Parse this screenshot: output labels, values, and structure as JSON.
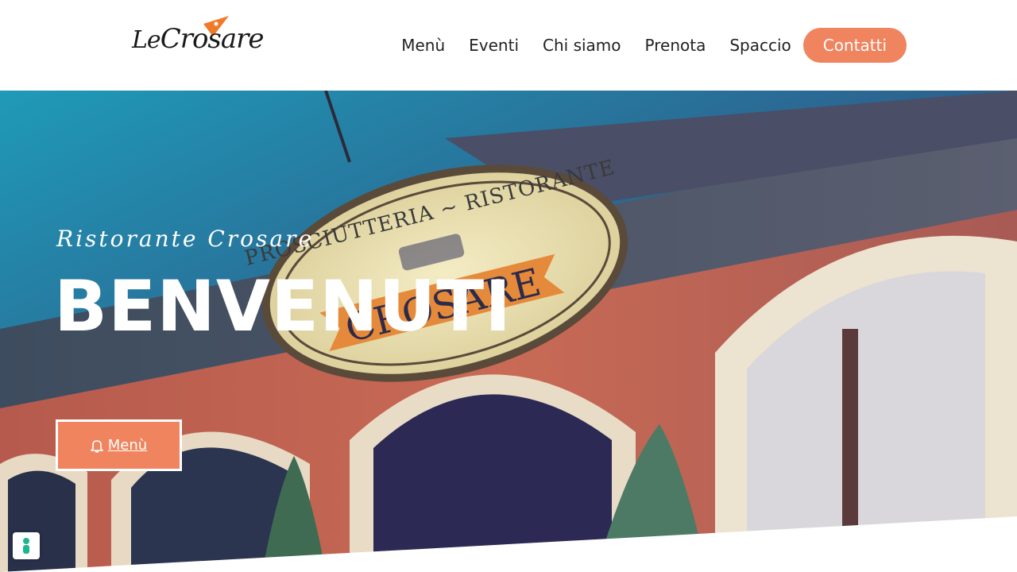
{
  "brand": {
    "logo_text_small": "Le",
    "logo_text_big": "Crosare",
    "accent_color": "#f0845f"
  },
  "nav": {
    "items": [
      {
        "label": "Menù"
      },
      {
        "label": "Eventi"
      },
      {
        "label": "Chi siamo"
      },
      {
        "label": "Prenota"
      },
      {
        "label": "Spaccio"
      }
    ],
    "cta_label": "Contatti"
  },
  "hero": {
    "subtitle": "Ristorante Crosare",
    "title": "BENVENUTI",
    "button_label": "Menù",
    "button_icon": "bell-icon",
    "sign_top_text": "PROSCIUTTERIA ~ RISTORANTE",
    "sign_main_text": "CROSARE"
  },
  "cookie_badge": {
    "icon": "cookie-consent-icon"
  }
}
